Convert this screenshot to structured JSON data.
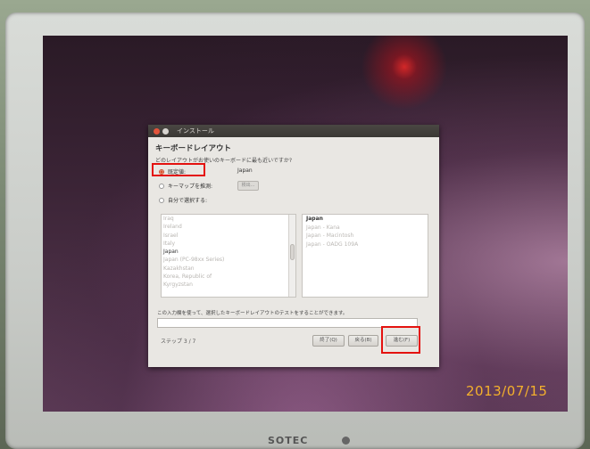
{
  "window": {
    "title": "インストール",
    "heading": "キーボードレイアウト",
    "question": "どのレイアウトがお使いのキーボードに最も近いですか?"
  },
  "options": {
    "default_label": "既定値:",
    "default_value": "Japan",
    "detect_label": "キーマップを推測:",
    "detect_button": "検出...",
    "choose_label": "自分で選択する:"
  },
  "layouts": {
    "countries": [
      "Iraq",
      "Ireland",
      "Israel",
      "Italy",
      "Japan",
      "Japan (PC-98xx Series)",
      "Kazakhstan",
      "Korea, Republic of",
      "Kyrgyzstan"
    ],
    "selected_country": "Japan",
    "variants": [
      "Japan",
      "Japan - Kana",
      "Japan - Macintosh",
      "Japan - OADG 109A"
    ],
    "selected_variant": "Japan"
  },
  "test": {
    "label": "この入力欄を使って、選択したキーボードレイアウトのテストをすることができます。",
    "value": ""
  },
  "footer": {
    "step": "ステップ 3 / 7",
    "quit": "終了(Q)",
    "back": "戻る(B)",
    "next": "進む(F)"
  },
  "photo": {
    "date_stamp": "2013/07/15",
    "monitor_brand": "SOTEC"
  },
  "colors": {
    "highlight": "#e4120f",
    "radio_accent": "#d9532d",
    "date_stamp": "#f4b02c"
  }
}
